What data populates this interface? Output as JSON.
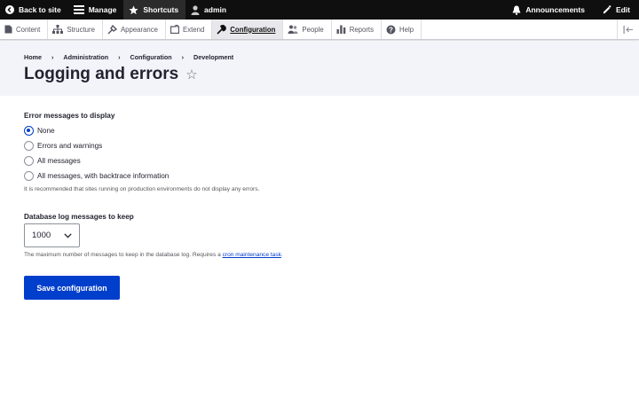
{
  "toolbar": {
    "back_to_site": "Back to site",
    "manage": "Manage",
    "shortcuts": "Shortcuts",
    "user": "admin",
    "announcements": "Announcements",
    "edit": "Edit"
  },
  "tray": {
    "items": [
      {
        "label": "Content",
        "icon": "content-icon"
      },
      {
        "label": "Structure",
        "icon": "structure-icon"
      },
      {
        "label": "Appearance",
        "icon": "appearance-icon"
      },
      {
        "label": "Extend",
        "icon": "extend-icon"
      },
      {
        "label": "Configuration",
        "icon": "wrench-icon",
        "active": true
      },
      {
        "label": "People",
        "icon": "people-icon"
      },
      {
        "label": "Reports",
        "icon": "reports-icon"
      },
      {
        "label": "Help",
        "icon": "help-icon"
      }
    ]
  },
  "breadcrumb": [
    "Home",
    "Administration",
    "Configuration",
    "Development"
  ],
  "page": {
    "title": "Logging and errors",
    "star": "☆"
  },
  "errors": {
    "legend": "Error messages to display",
    "options": [
      "None",
      "Errors and warnings",
      "All messages",
      "All messages, with backtrace information"
    ],
    "selected": "None",
    "description": "It is recommended that sites running on production environments do not display any errors."
  },
  "dblog": {
    "label": "Database log messages to keep",
    "value": "1000",
    "description_prefix": "The maximum number of messages to keep in the database log. Requires a ",
    "description_link": "cron maintenance task",
    "description_suffix": "."
  },
  "actions": {
    "save_label": "Save configuration"
  },
  "colors": {
    "primary": "#003ecc",
    "toolbar_bg": "#0f0f0f",
    "header_bg": "#f3f4f9"
  }
}
